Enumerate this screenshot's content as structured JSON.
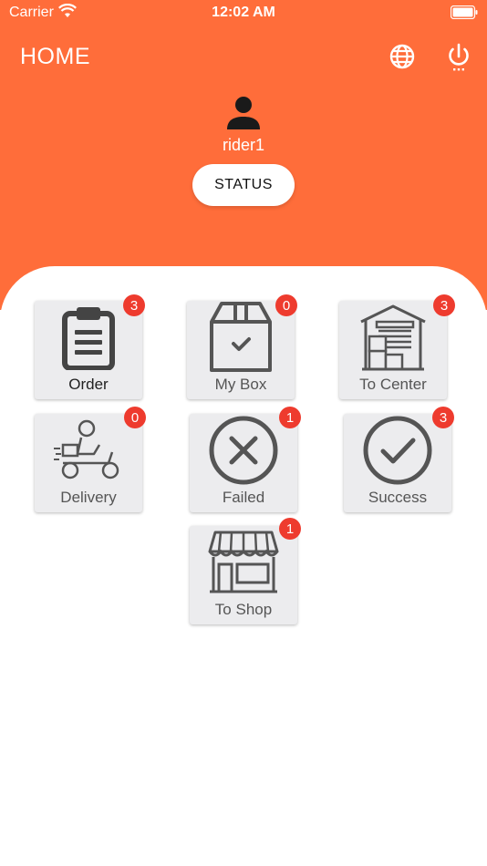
{
  "status_bar": {
    "carrier": "Carrier",
    "time": "12:02 AM"
  },
  "header": {
    "title": "HOME",
    "globe_icon": "globe-icon",
    "power_icon": "power-icon"
  },
  "profile": {
    "username": "rider1",
    "status_label": "STATUS"
  },
  "colors": {
    "header": "#FF6D3A",
    "badge": "#EE3B2E",
    "tile": "#ECECEE",
    "icon": "#555555"
  },
  "tiles": [
    {
      "label": "Order",
      "badge": "3",
      "icon": "clipboard-icon"
    },
    {
      "label": "My Box",
      "badge": "0",
      "icon": "box-icon"
    },
    {
      "label": "To Center",
      "badge": "3",
      "icon": "warehouse-icon"
    },
    {
      "label": "Delivery",
      "badge": "0",
      "icon": "delivery-scooter-icon"
    },
    {
      "label": "Failed",
      "badge": "1",
      "icon": "x-circle-icon"
    },
    {
      "label": "Success",
      "badge": "3",
      "icon": "check-circle-icon"
    },
    {
      "label": "To Shop",
      "badge": "1",
      "icon": "shop-icon"
    }
  ]
}
